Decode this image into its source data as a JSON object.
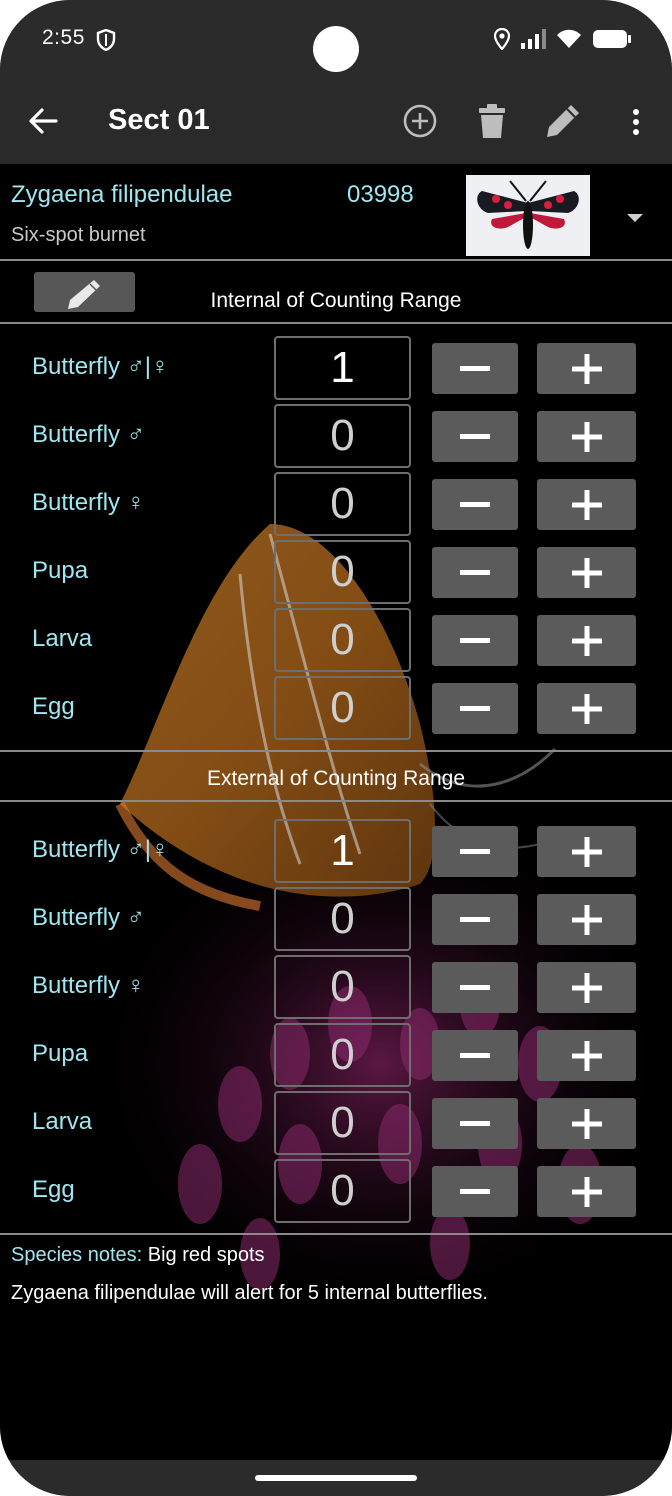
{
  "status": {
    "time": "2:55",
    "icons": [
      "shield-icon",
      "location-icon",
      "signal-icon",
      "wifi-icon",
      "battery-icon"
    ]
  },
  "appbar": {
    "title": "Sect 01",
    "actions": [
      "back-arrow-icon",
      "add-circle-icon",
      "trash-icon",
      "pencil-icon",
      "more-vert-icon"
    ]
  },
  "species": {
    "name": "Zygaena filipendulae",
    "code": "03998",
    "common": "Six-spot burnet"
  },
  "internal": {
    "title": "Internal of Counting Range",
    "rows": [
      {
        "label": "Butterfly ♂|♀",
        "value": "1"
      },
      {
        "label": "Butterfly ♂",
        "value": "0"
      },
      {
        "label": "Butterfly ♀",
        "value": "0"
      },
      {
        "label": "Pupa",
        "value": "0"
      },
      {
        "label": "Larva",
        "value": "0"
      },
      {
        "label": "Egg",
        "value": "0"
      }
    ]
  },
  "external": {
    "title": "External of Counting Range",
    "rows": [
      {
        "label": "Butterfly ♂|♀",
        "value": "1"
      },
      {
        "label": "Butterfly ♂",
        "value": "0"
      },
      {
        "label": "Butterfly ♀",
        "value": "0"
      },
      {
        "label": "Pupa",
        "value": "0"
      },
      {
        "label": "Larva",
        "value": "0"
      },
      {
        "label": "Egg",
        "value": "0"
      }
    ]
  },
  "notes": {
    "label": "Species notes:",
    "text": "Big red spots",
    "alert": "Zygaena filipendulae will alert for 5 internal butterflies."
  },
  "colors": {
    "accent_text": "#9fe6f0",
    "button_bg": "#5b5b5b",
    "background": "#000000"
  }
}
